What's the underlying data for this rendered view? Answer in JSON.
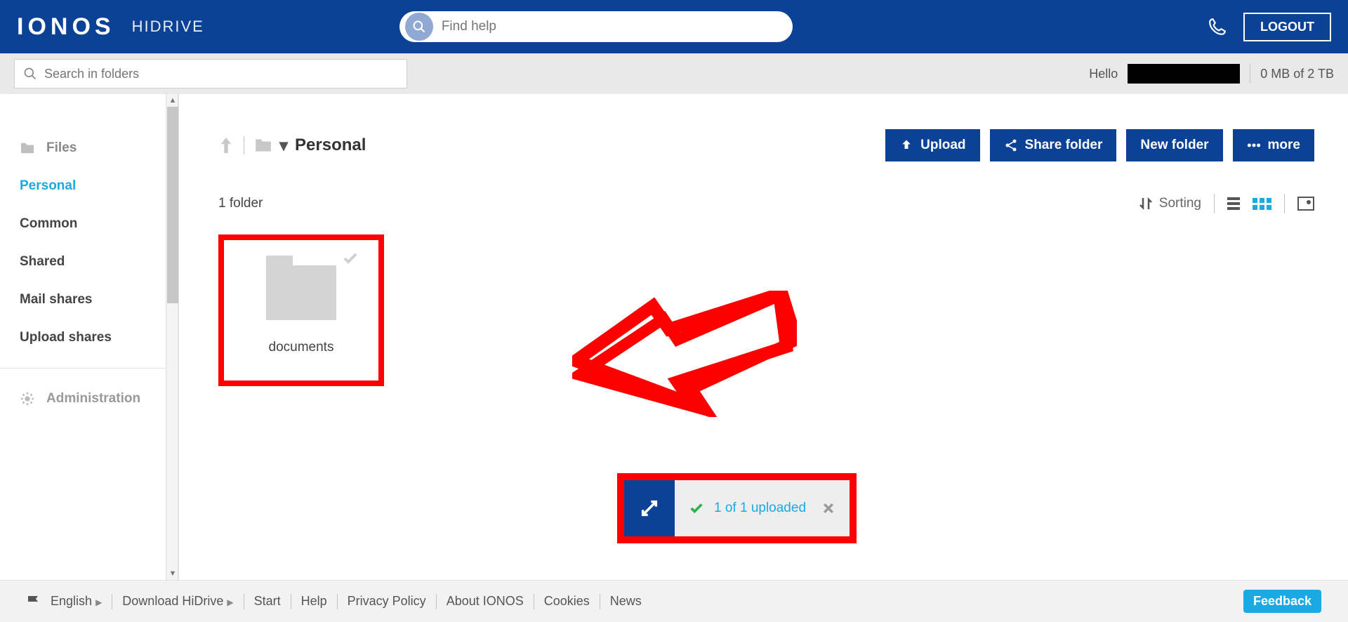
{
  "header": {
    "logo": "IONOS",
    "product": "HIDRIVE",
    "help_placeholder": "Find help",
    "logout": "LOGOUT"
  },
  "subbar": {
    "search_placeholder": "Search in folders",
    "hello_prefix": "Hello",
    "storage": "0 MB of 2 TB"
  },
  "sidebar": {
    "files_label": "Files",
    "items": [
      "Personal",
      "Common",
      "Shared",
      "Mail shares",
      "Upload shares"
    ],
    "admin_label": "Administration"
  },
  "content": {
    "breadcrumb": "Personal",
    "actions": {
      "upload": "Upload",
      "share": "Share folder",
      "newfolder": "New folder",
      "more": "more"
    },
    "folder_count": "1 folder",
    "sorting_label": "Sorting",
    "tile_name": "documents"
  },
  "upload_status": {
    "text": "1 of 1 uploaded"
  },
  "footer": {
    "language": "English",
    "download": "Download HiDrive",
    "links": [
      "Start",
      "Help",
      "Privacy Policy",
      "About IONOS",
      "Cookies",
      "News"
    ],
    "feedback": "Feedback"
  }
}
